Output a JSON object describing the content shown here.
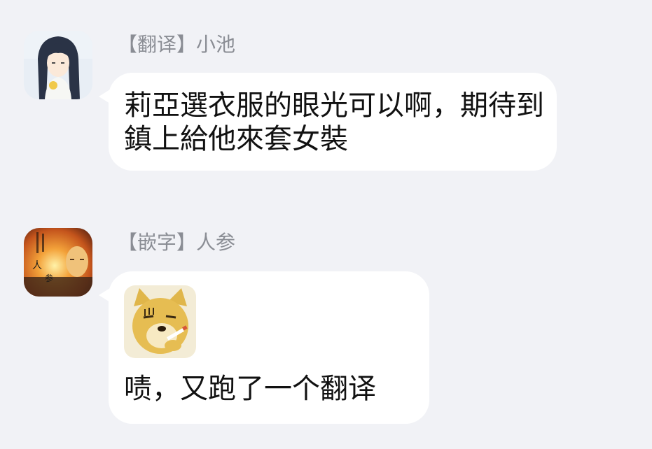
{
  "messages": [
    {
      "avatar_icon": "anime-girl-avatar-icon",
      "sender_tag": "【翻译】",
      "sender_name": "小池",
      "text": "莉亞選衣服的眼光可以啊，期待到鎮上給他來套女裝"
    },
    {
      "avatar_icon": "ginseng-poster-avatar-icon",
      "sender_tag": "【嵌字】",
      "sender_name": "人参",
      "sticker_icon": "doge-smoking-sticker-icon",
      "text": "啧，又跑了一个翻译"
    }
  ],
  "colors": {
    "background": "#f1f2f6",
    "bubble": "#ffffff",
    "sender_text": "#8a8d94",
    "message_text": "#111111"
  }
}
